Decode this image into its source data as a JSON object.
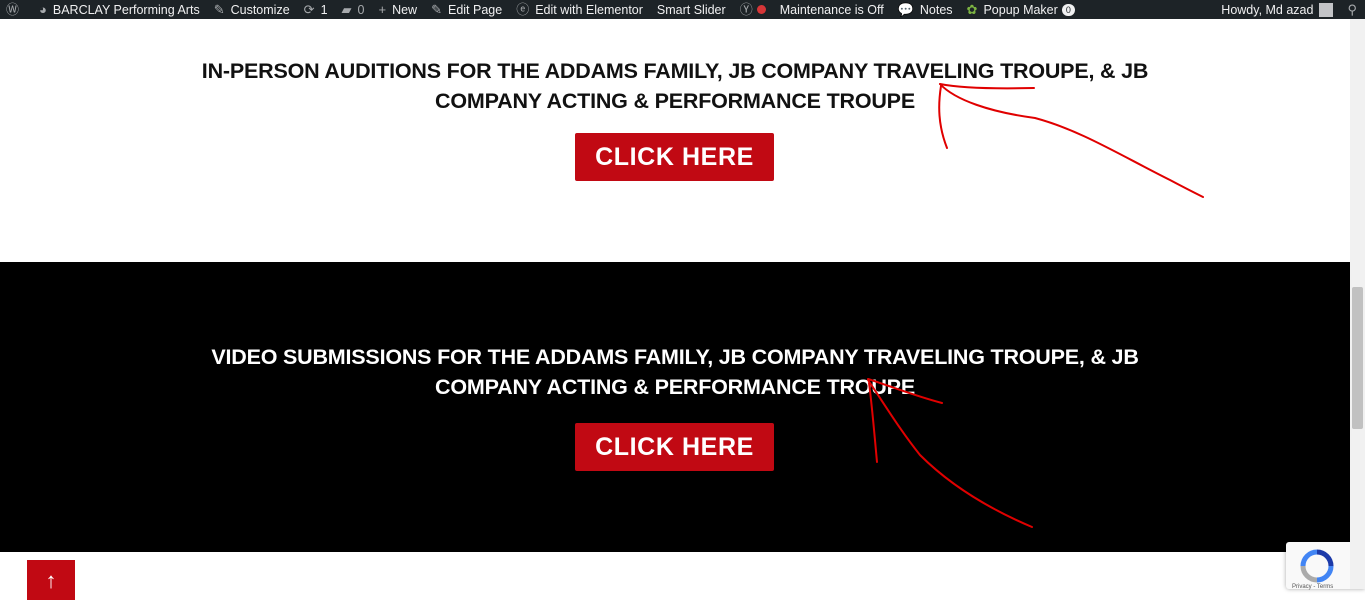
{
  "admin_bar": {
    "site_name": "BARCLAY Performing Arts",
    "customize": "Customize",
    "updates_count": "1",
    "comments_count": "0",
    "new_label": "New",
    "edit_page": "Edit Page",
    "edit_elementor": "Edit with Elementor",
    "smart_slider": "Smart Slider",
    "maintenance": "Maintenance is Off",
    "notes": "Notes",
    "popup_maker": "Popup Maker",
    "popup_count": "0",
    "greeting": "Howdy, Md azad"
  },
  "sections": {
    "inperson": {
      "heading": "IN-PERSON AUDITIONS FOR THE ADDAMS FAMILY, JB COMPANY TRAVELING TROUPE, & JB COMPANY ACTING & PERFORMANCE TROUPE",
      "button_label": "CLICK HERE"
    },
    "video": {
      "heading": "VIDEO SUBMISSIONS FOR THE ADDAMS FAMILY, JB COMPANY TRAVELING TROUPE, & JB COMPANY ACTING & PERFORMANCE TROUPE",
      "button_label": "CLICK HERE"
    }
  },
  "back_to_top_glyph": "↑",
  "recaptcha": {
    "text": "Privacy - Terms"
  },
  "colors": {
    "admin_bar_bg": "#1d2327",
    "button_red": "#c10913",
    "video_section_bg": "#000000",
    "annotation_red": "#e00000"
  }
}
